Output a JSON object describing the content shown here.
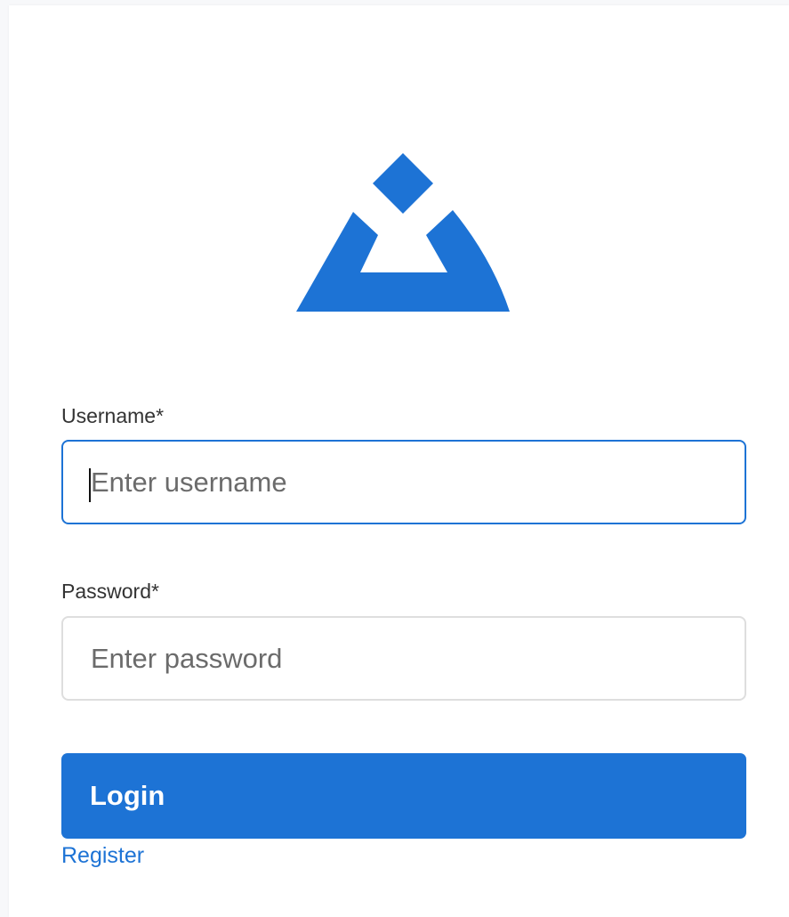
{
  "logo": {
    "icon": "brand-logo-icon",
    "color": "#1d73d5"
  },
  "form": {
    "username": {
      "label": "Username*",
      "placeholder": "Enter username",
      "value": ""
    },
    "password": {
      "label": "Password*",
      "placeholder": "Enter password",
      "value": ""
    },
    "login_label": "Login",
    "register_label": "Register"
  },
  "colors": {
    "accent": "#1d73d5",
    "border": "#dedede",
    "background": "#f7f8fa"
  }
}
